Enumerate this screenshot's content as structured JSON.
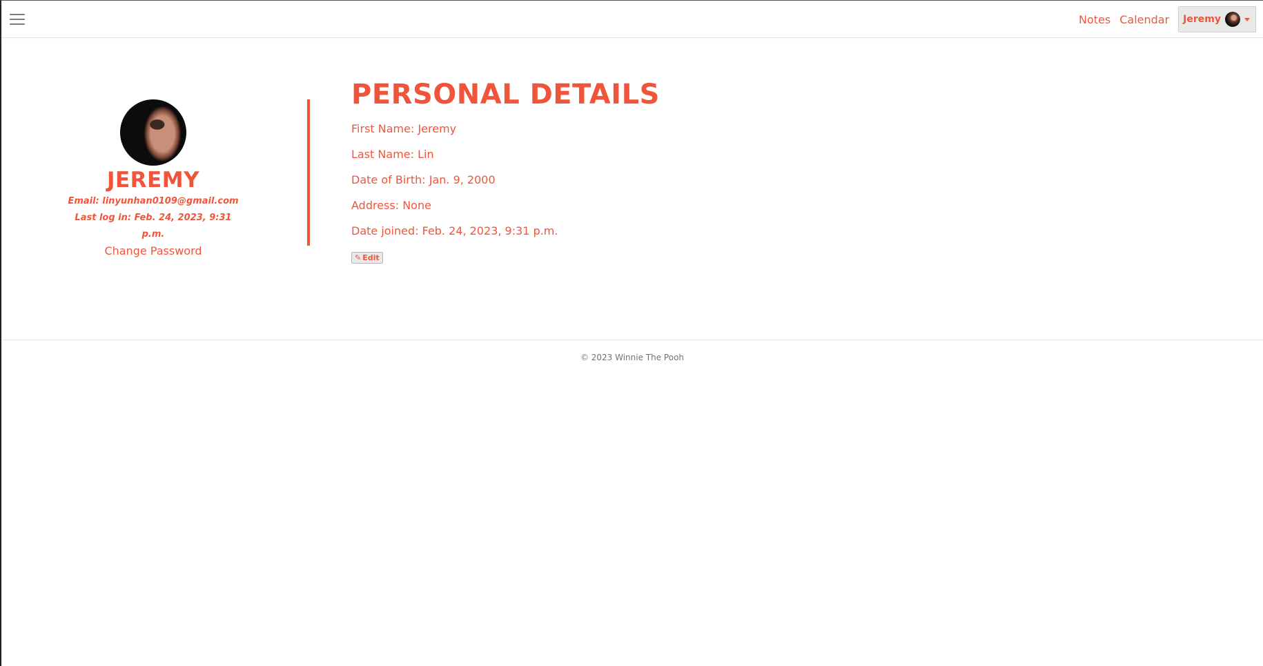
{
  "navbar": {
    "links": [
      "Notes",
      "Calendar"
    ],
    "user_label": "Jeremy"
  },
  "profile": {
    "name": "JEREMY",
    "email": "Email: linyunhan0109@gmail.com",
    "last_login": "Last log in: Feb. 24, 2023, 9:31 p.m.",
    "change_password": "Change Password"
  },
  "details": {
    "title": "PERSONAL DETAILS",
    "first_name": "First Name: Jeremy",
    "last_name": "Last Name: Lin",
    "dob": "Date of Birth: Jan. 9, 2000",
    "address": "Address: None",
    "date_joined": "Date joined: Feb. 24, 2023, 9:31 p.m.",
    "edit_label": "Edit"
  },
  "footer": {
    "text": "© 2023 Winnie The Pooh"
  },
  "theme": {
    "accent": "#f0553b",
    "icons": [
      "hamburger-icon",
      "avatar",
      "caret-down-icon",
      "edit-icon"
    ]
  }
}
